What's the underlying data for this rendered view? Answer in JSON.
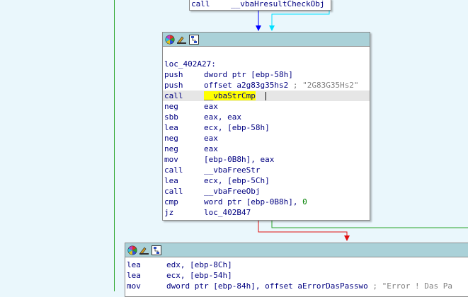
{
  "top_block": {
    "mnemonic": "call",
    "operand": "__vbaHresultCheckObj"
  },
  "main_block": {
    "label": "loc_402A27:",
    "rows": [
      {
        "mn": "push",
        "op": "dword ptr [ebp-58h]",
        "num": "",
        "cmt": ""
      },
      {
        "mn": "push",
        "op": "offset a2g83g35hs2",
        "num": "",
        "cmt": " ; \"2G83G35Hs2\""
      },
      {
        "mn": "call",
        "op": "__vbaStrCmp",
        "num": "",
        "cmt": ""
      },
      {
        "mn": "neg",
        "op": "eax",
        "num": "",
        "cmt": ""
      },
      {
        "mn": "sbb",
        "op": "eax, eax",
        "num": "",
        "cmt": ""
      },
      {
        "mn": "lea",
        "op": "ecx, [ebp-58h]",
        "num": "",
        "cmt": ""
      },
      {
        "mn": "neg",
        "op": "eax",
        "num": "",
        "cmt": ""
      },
      {
        "mn": "neg",
        "op": "eax",
        "num": "",
        "cmt": ""
      },
      {
        "mn": "mov",
        "op": "[ebp-0B8h], eax",
        "num": "",
        "cmt": ""
      },
      {
        "mn": "call",
        "op": "__vbaFreeStr",
        "num": "",
        "cmt": ""
      },
      {
        "mn": "lea",
        "op": "ecx, [ebp-5Ch]",
        "num": "",
        "cmt": ""
      },
      {
        "mn": "call",
        "op": "__vbaFreeObj",
        "num": "",
        "cmt": ""
      },
      {
        "mn": "cmp",
        "op": "word ptr [ebp-0B8h], ",
        "num": "0",
        "cmt": ""
      },
      {
        "mn": "jz",
        "op": "loc_402B47",
        "num": "",
        "cmt": ""
      }
    ]
  },
  "bottom_block": {
    "rows": [
      {
        "mn": "lea",
        "op": "edx, [ebp-8Ch]",
        "cmt": ""
      },
      {
        "mn": "lea",
        "op": "ecx, [ebp-54h]",
        "cmt": ""
      },
      {
        "mn": "mov",
        "op": "dword ptr [ebp-84h], offset aErrorDasPasswo",
        "cmt": " ; \"Error ! Das Pa"
      }
    ]
  },
  "icons": [
    "color-palette-icon",
    "rename-icon",
    "graph-overview-icon"
  ],
  "colors": {
    "background": "#eaf7fc",
    "titlebar": "#aad1d8",
    "edge_blue": "#0000ff",
    "edge_cyan": "#00e0ff",
    "edge_green": "#2aa52a",
    "edge_red": "#e01010",
    "highlight": "#ffff00"
  }
}
